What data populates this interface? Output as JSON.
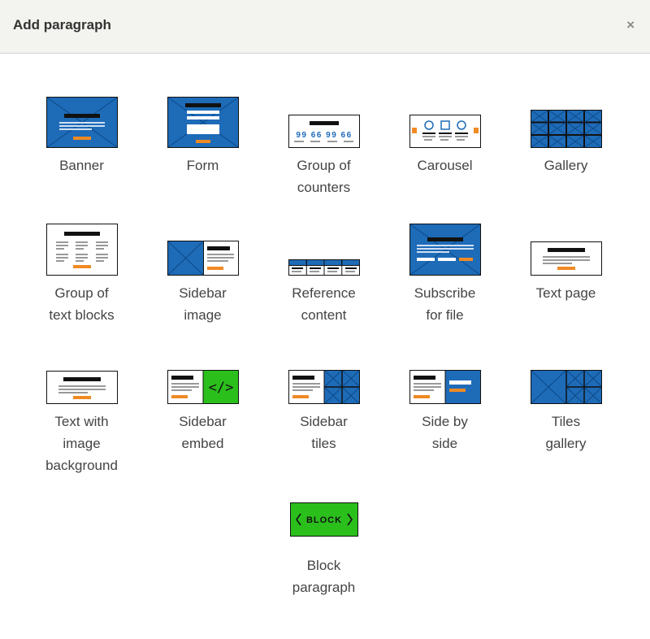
{
  "dialog": {
    "title": "Add paragraph",
    "close_glyph": "×"
  },
  "paragraphs": [
    {
      "id": "banner",
      "line1": "Banner",
      "line2": "",
      "line3": ""
    },
    {
      "id": "form",
      "line1": "Form",
      "line2": "",
      "line3": ""
    },
    {
      "id": "group-of-counters",
      "line1": "Group of",
      "line2": "counters",
      "line3": ""
    },
    {
      "id": "carousel",
      "line1": "Carousel",
      "line2": "",
      "line3": ""
    },
    {
      "id": "gallery",
      "line1": "Gallery",
      "line2": "",
      "line3": ""
    },
    {
      "id": "group-of-text-blocks",
      "line1": "Group of",
      "line2": "text blocks",
      "line3": ""
    },
    {
      "id": "sidebar-image",
      "line1": "Sidebar",
      "line2": "image",
      "line3": ""
    },
    {
      "id": "reference-content",
      "line1": "Reference",
      "line2": "content",
      "line3": ""
    },
    {
      "id": "subscribe-for-file",
      "line1": "Subscribe",
      "line2": "for file",
      "line3": ""
    },
    {
      "id": "text-page",
      "line1": "Text page",
      "line2": "",
      "line3": ""
    },
    {
      "id": "text-with-image-background",
      "line1": "Text with",
      "line2": "image",
      "line3": "background"
    },
    {
      "id": "sidebar-embed",
      "line1": "Sidebar",
      "line2": "embed",
      "line3": ""
    },
    {
      "id": "sidebar-tiles",
      "line1": "Sidebar",
      "line2": "tiles",
      "line3": ""
    },
    {
      "id": "side-by-side",
      "line1": "Side by",
      "line2": "side",
      "line3": ""
    },
    {
      "id": "tiles-gallery",
      "line1": "Tiles",
      "line2": "gallery",
      "line3": ""
    },
    {
      "id": "block-paragraph",
      "line1": "Block",
      "line2": "paragraph",
      "line3": ""
    }
  ],
  "icons": {
    "counters_text": "99 66 99 66",
    "embed_glyph": "</>",
    "block_text": "BLOCK"
  },
  "colors": {
    "blue": "#1e6bb8",
    "orange": "#f08a24",
    "green": "#2bbf1c",
    "dark": "#111111"
  }
}
